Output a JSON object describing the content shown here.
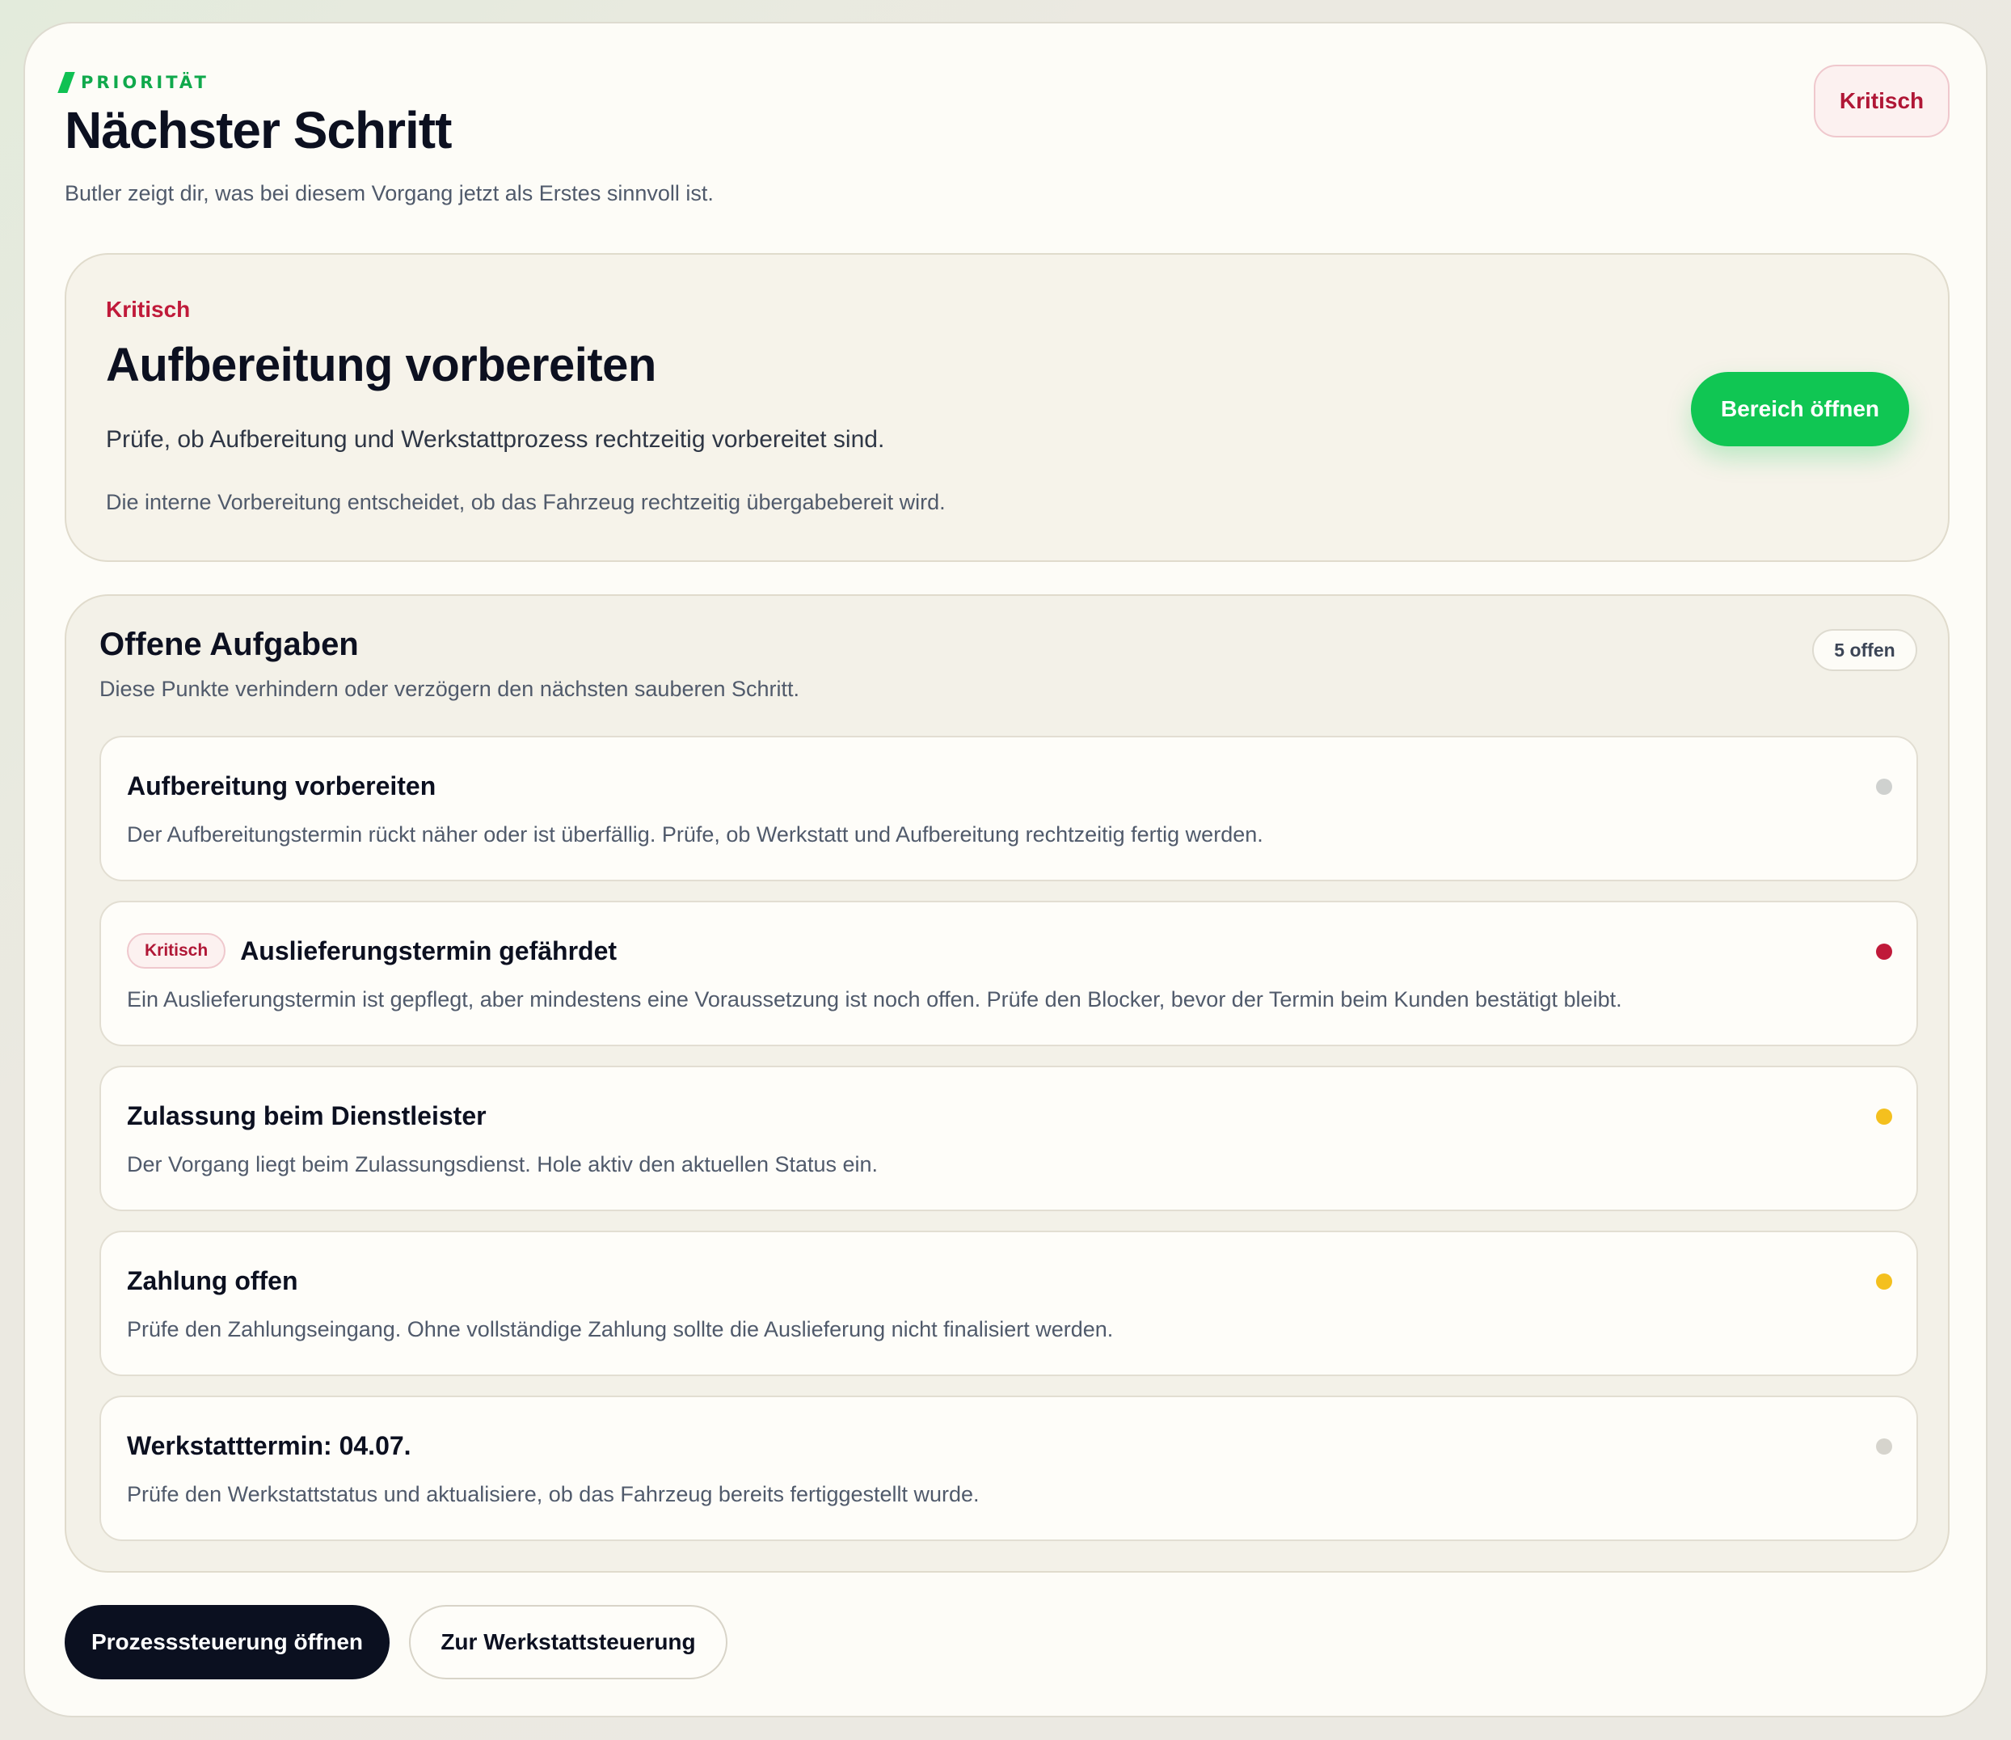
{
  "header": {
    "eyebrow": "PRIORITÄT",
    "title": "Nächster Schritt",
    "subtitle": "Butler zeigt dir, was bei diesem Vorgang jetzt als Erstes sinnvoll ist.",
    "badge": "Kritisch"
  },
  "hero": {
    "severity": "Kritisch",
    "title": "Aufbereitung vorbereiten",
    "description": "Prüfe, ob Aufbereitung und Werkstattprozess rechtzeitig vorbereitet sind.",
    "note": "Die interne Vorbereitung entscheidet, ob das Fahrzeug rechtzeitig übergabebereit wird.",
    "button_label": "Bereich öffnen"
  },
  "tasks": {
    "heading": "Offene Aufgaben",
    "subtitle": "Diese Punkte verhindern oder verzögern den nächsten sauberen Schritt.",
    "count_label": "5 offen",
    "items": [
      {
        "title": "Aufbereitung vorbereiten",
        "chip": "",
        "description": "Der Aufbereitungstermin rückt näher oder ist überfällig. Prüfe, ob Werkstatt und Aufbereitung rechtzeitig fertig werden.",
        "status_color": "#cfd1cf"
      },
      {
        "title": "Auslieferungstermin gefährdet",
        "chip": "Kritisch",
        "description": "Ein Auslieferungstermin ist gepflegt, aber mindestens eine Voraussetzung ist noch offen. Prüfe den Blocker, bevor der Termin beim Kunden bestätigt bleibt.",
        "status_color": "#c01a3a"
      },
      {
        "title": "Zulassung beim Dienstleister",
        "chip": "",
        "description": "Der Vorgang liegt beim Zulassungsdienst. Hole aktiv den aktuellen Status ein.",
        "status_color": "#f4c01e"
      },
      {
        "title": "Zahlung offen",
        "chip": "",
        "description": "Prüfe den Zahlungseingang. Ohne vollständige Zahlung sollte die Auslieferung nicht finalisiert werden.",
        "status_color": "#f4c01e"
      },
      {
        "title": "Werkstatttermin: 04.07.",
        "chip": "",
        "description": "Prüfe den Werkstattstatus und aktualisiere, ob das Fahrzeug bereits fertiggestellt wurde.",
        "status_color": "#d6d4cd"
      }
    ]
  },
  "footer": {
    "primary_label": "Prozesssteuerung öffnen",
    "secondary_label": "Zur Werkstattsteuerung"
  },
  "colors": {
    "accent_green": "#10c653",
    "critical_red": "#c01a3a",
    "dark_button": "#0b1020"
  }
}
